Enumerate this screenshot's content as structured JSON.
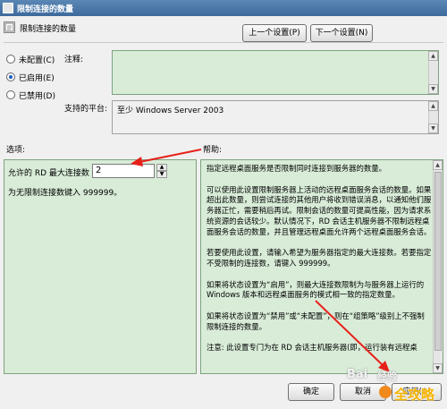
{
  "window": {
    "title": "限制连接的数量"
  },
  "header": {
    "setting_name": "限制连接的数量",
    "prev_button": "上一个设置(P)",
    "next_button": "下一个设置(N)"
  },
  "options": {
    "not_configured": "未配置(C)",
    "enabled": "已启用(E)",
    "disabled": "已禁用(D)",
    "selected": "enabled"
  },
  "comment": {
    "label": "注释:",
    "value": ""
  },
  "platform": {
    "label": "支持的平台:",
    "value": "至少 Windows Server 2003"
  },
  "sections": {
    "options_label": "选项:",
    "help_label": "帮助:"
  },
  "options_pane": {
    "max_connections_label": "允许的 RD 最大连接数",
    "max_connections_value": "2",
    "unlimited_hint": "为无限制连接数键入 999999。"
  },
  "help": {
    "paragraphs": [
      "指定远程桌面服务是否限制同时连接到服务器的数量。",
      "可以使用此设置限制服务器上活动的远程桌面服务会话的数量。如果超出此数量，则尝试连接的其他用户将收到错误消息，以通知他们服务器正忙，需要稍后再试。限制会话的数量可提高性能，因为请求系统资源的会话较少。默认情况下，RD 会话主机服务器不限制远程桌面服务会话的数量，并且管理远程桌面允许两个远程桌面服务会话。",
      "若要使用此设置，请输入希望为服务器指定的最大连接数。若要指定不受限制的连接数，请键入 999999。",
      "如果将状态设置为“启用”，则最大连接数限制为与服务器上运行的 Windows 版本和远程桌面服务的模式相一致的指定数量。",
      "如果将状态设置为“禁用”或“未配置”，则在“组策略”级别上不强制限制连接的数量。",
      "注意: 此设置专门为在 RD 会话主机服务器(即，运行装有远程桌"
    ]
  },
  "footer": {
    "ok_button": "确定",
    "cancel_button": "取消",
    "apply_button": "应用(A)"
  },
  "watermark": {
    "text1": "Bai",
    "text2": "经验",
    "text3": "全攻略"
  },
  "colors": {
    "pane_bg": "#d8ecd8",
    "arrow": "#e8201a",
    "title_bar": "#4a77a8"
  }
}
